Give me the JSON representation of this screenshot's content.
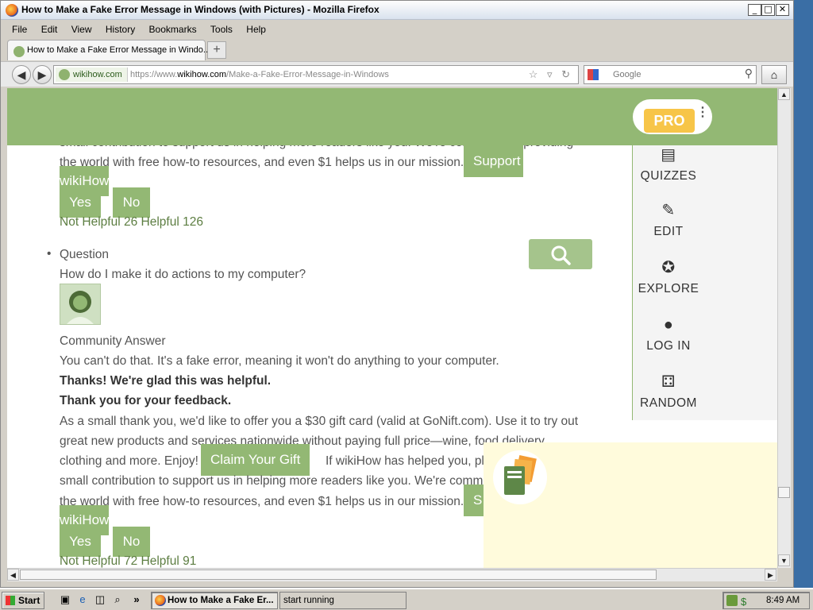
{
  "window": {
    "title": "How to Make a Fake Error Message in Windows (with Pictures) - Mozilla Firefox",
    "controls": {
      "minimize": "_",
      "maximize": "□",
      "close": "✕"
    }
  },
  "menu": [
    "File",
    "Edit",
    "View",
    "History",
    "Bookmarks",
    "Tools",
    "Help"
  ],
  "tab": {
    "label": "How to Make a Fake Error Message in Windo...",
    "new_tab": "+"
  },
  "nav": {
    "back": "◀",
    "forward": "▶",
    "site_identity": "wikihow.com",
    "url_prefix": "https://www.",
    "url_domain": "wikihow.com",
    "url_path": "/Make-a-Fake-Error-Message-in-Windows",
    "url_icons": "☆ ▿ ↻",
    "search_placeholder": "Google",
    "search_icon": "⚲",
    "home_icon": "⌂"
  },
  "header": {
    "pro_label": "PRO",
    "menu_dots": "⋮",
    "color": "#93b874",
    "pro_color": "#f7c548"
  },
  "sidebar": {
    "items": [
      {
        "label": "QUIZZES",
        "icon": "quiz-icon",
        "glyph": "▤"
      },
      {
        "label": "EDIT",
        "icon": "pencil-icon",
        "glyph": "✎"
      },
      {
        "label": "EXPLORE",
        "icon": "compass-icon",
        "glyph": "✪"
      },
      {
        "label": "LOG IN",
        "icon": "user-icon",
        "glyph": "●"
      },
      {
        "label": "RANDOM",
        "icon": "dice-icon",
        "glyph": "⚃"
      }
    ]
  },
  "answer1": {
    "line1": "small contribution to support us in helping more readers like you. We're committed to providing",
    "line2": "the world with free how-to resources, and even $1 helps us in our mission.",
    "support_button": "Support wikiHow",
    "support_button_line1": "Support",
    "support_button_line2": "wikiHow",
    "yes": "Yes",
    "no": "No",
    "stats": "Not Helpful 26 Helpful 126"
  },
  "question": {
    "bullet": "•",
    "label": "Question",
    "text": "How do I make it do actions to my computer?",
    "answer_label": "Community Answer",
    "answer_text": "You can't do that. It's a fake error, meaning it won't do anything to your computer.",
    "thanks": "Thanks! We're glad this was helpful.",
    "feedback": "Thank you for your feedback.",
    "offer_line1": "As a small thank you, we'd like to offer you a $30 gift card (valid at GoNift.com). Use it to try out",
    "offer_line2": "great new products and services nationwide without paying full price—wine, food delivery,",
    "offer_line3_a": "clothing and more. Enjoy!",
    "claim_button": "Claim Your Gift",
    "offer_line3_b": "If wikiHow has helped you, pl",
    "offer_line4": "small contribution to support us in helping more readers like you. We're comm",
    "offer_line5": "the world with free how-to resources, and even $1 helps us in our mission.",
    "support_button_line1": "S",
    "support_button_line2": "wikiHow",
    "yes": "Yes",
    "no": "No",
    "stats": "Not Helpful 72 Helpful 91"
  },
  "taskbar": {
    "start": "Start",
    "tasks": [
      {
        "label": "How to Make a Fake Er...",
        "active": true
      },
      {
        "label": "start running",
        "active": false
      }
    ],
    "clock": "8:49 AM",
    "quicklaunch_more": "»"
  }
}
